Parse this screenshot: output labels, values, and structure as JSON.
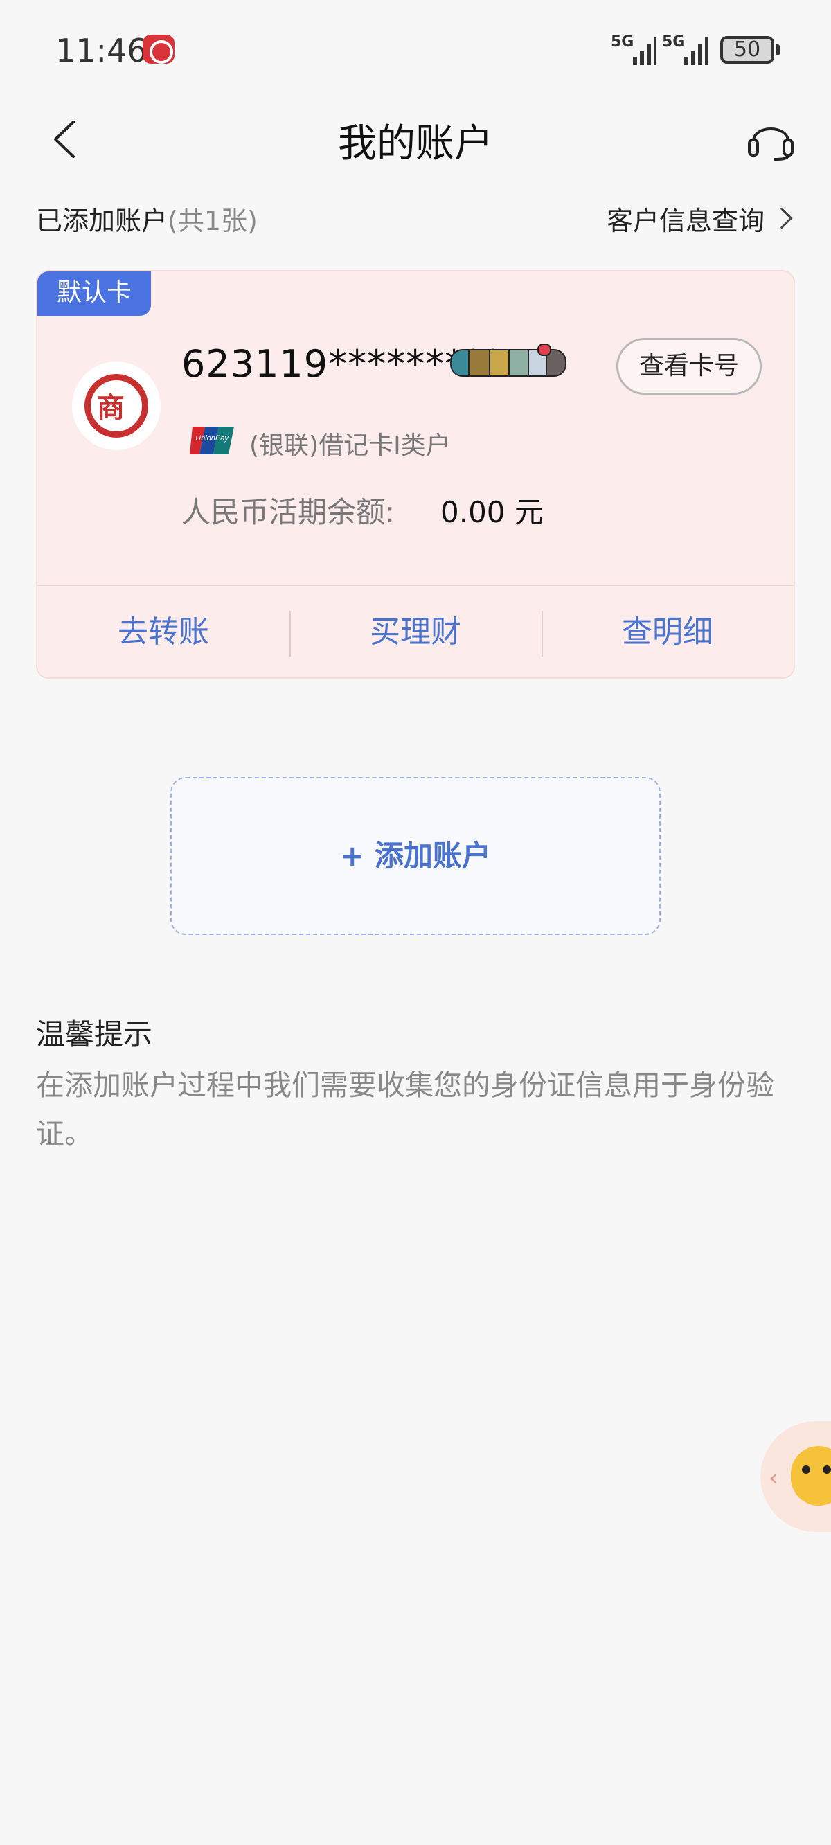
{
  "status_bar": {
    "time": "11:46",
    "network_1": "5G",
    "network_2": "5G",
    "battery": "50"
  },
  "nav": {
    "title": "我的账户"
  },
  "sub_header": {
    "added_label": "已添加账户",
    "added_count": "(共1张)",
    "customer_info": "客户信息查询"
  },
  "card": {
    "default_tag": "默认卡",
    "bank_mark": "商",
    "number": "623119*********",
    "view_button": "查看卡号",
    "type": "(银联)借记卡I类户",
    "balance_label": "人民币活期余额:",
    "balance_value": "0.00 元",
    "actions": [
      "去转账",
      "买理财",
      "查明细"
    ]
  },
  "add_account": {
    "label": "+ 添加账户"
  },
  "tips": {
    "title": "温馨提示",
    "text": "在添加账户过程中我们需要收集您的身份证信息用于身份验证。"
  },
  "colors": {
    "accent": "#4a72cf",
    "card_bg": "#fdecec",
    "bank_red": "#c82f2f"
  }
}
